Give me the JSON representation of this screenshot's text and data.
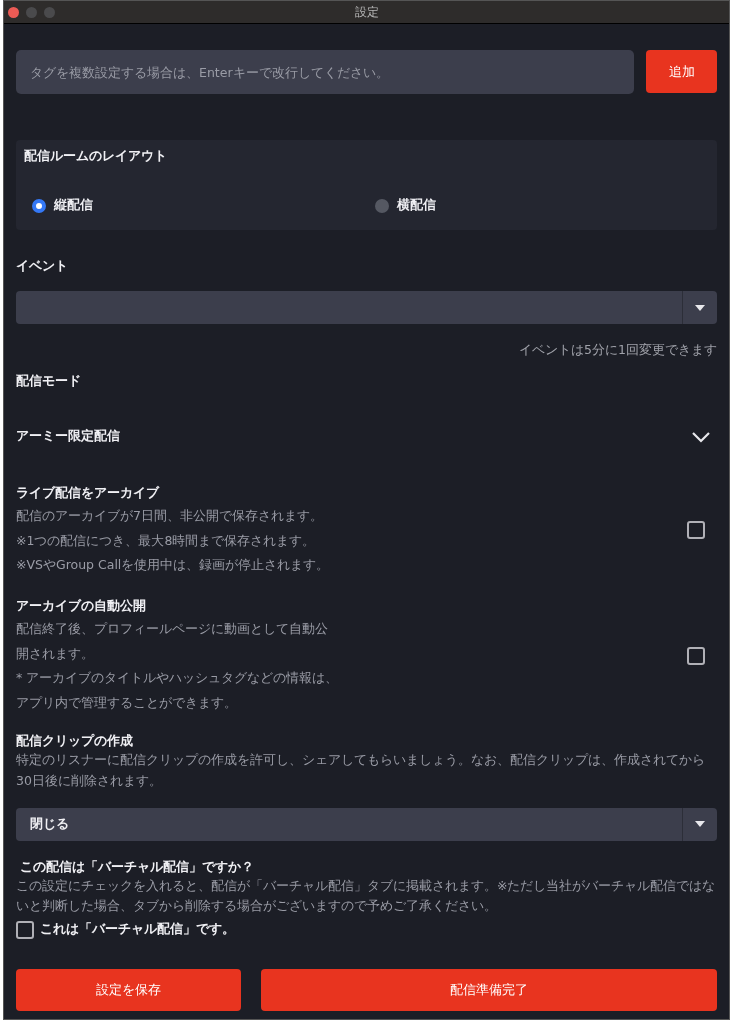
{
  "window": {
    "title": "設定"
  },
  "tag_input": {
    "placeholder": "タグを複数設定する場合は、Enterキーで改行してください。",
    "button": "追加"
  },
  "layout": {
    "title": "配信ルームのレイアウト",
    "options": [
      {
        "label": "縦配信",
        "selected": true
      },
      {
        "label": "横配信",
        "selected": false
      }
    ]
  },
  "event": {
    "label": "イベント",
    "hint": "イベントは5分に1回変更できます"
  },
  "mode": {
    "label": "配信モード",
    "value": "アーミー限定配信"
  },
  "toggles": [
    {
      "title": "ライブ配信をアーカイブ",
      "lines": [
        "配信のアーカイブが7日間、非公開で保存されます。",
        "※1つの配信につき、最大8時間まで保存されます。",
        "※VSやGroup Callを使用中は、録画が停止されます。"
      ],
      "checked": false
    },
    {
      "title": "アーカイブの自動公開",
      "lines": [
        "配信終了後、プロフィールページに動画として自動公",
        "開されます。",
        "* アーカイブのタイトルやハッシュタグなどの情報は、",
        "アプリ内で管理することができます。"
      ],
      "checked": false
    }
  ],
  "clip": {
    "title": "配信クリップの作成",
    "description": "特定のリスナーに配信クリップの作成を許可し、シェアしてもらいましょう。なお、配信クリップは、作成されてから30日後に削除されます。",
    "value": "閉じる"
  },
  "virtual": {
    "title": "この配信は「バーチャル配信」ですか？",
    "description": "この設定にチェックを入れると、配信が「バーチャル配信」タブに掲載されます。※ただし当社がバーチャル配信ではないと判断した場合、タブから削除する場合がございますので予めご了承ください。",
    "checkbox_label": "これは「バーチャル配信」です。",
    "checked": false
  },
  "buttons": [
    {
      "label": "設定を保存"
    },
    {
      "label": "配信準備完了"
    }
  ]
}
